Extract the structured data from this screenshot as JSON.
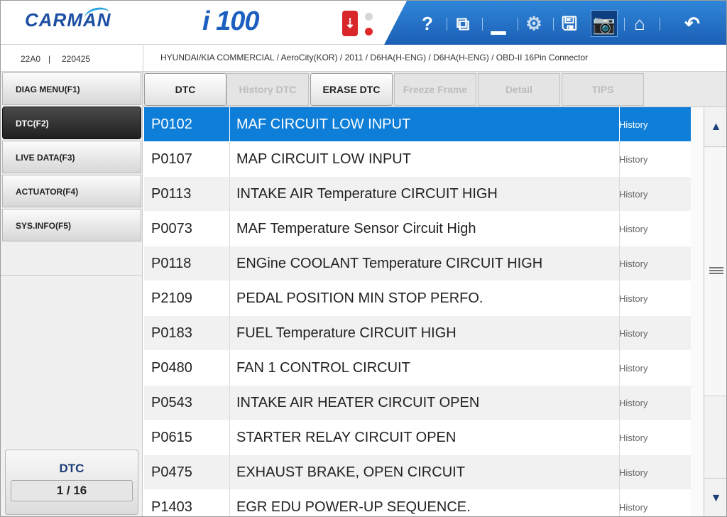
{
  "header": {
    "brand": "CARMAN",
    "model": "i 100",
    "icons": [
      "usb-icon",
      "help-icon",
      "window-icon",
      "minimize-icon",
      "settings-icon",
      "save-icon",
      "camera-icon",
      "home-icon",
      "back-icon"
    ],
    "toolbar": {
      "help": "?",
      "window": "⧉",
      "minimize": "▁",
      "settings": "⚙",
      "save": "🖫",
      "camera": "📷",
      "home": "⌂",
      "back": "↶"
    },
    "usb_label": "⇣"
  },
  "info": {
    "code": "22A0",
    "separator": "|",
    "date": "220425",
    "breadcrumb": "HYUNDAI/KIA COMMERCIAL / AeroCity(KOR) / 2011 / D6HA(H-ENG) / D6HA(H-ENG) / OBD-II 16Pin Connector"
  },
  "sidebar": {
    "items": [
      {
        "label": "DIAG MENU(F1)"
      },
      {
        "label": "DTC(F2)"
      },
      {
        "label": "LIVE DATA(F3)"
      },
      {
        "label": "ACTUATOR(F4)"
      },
      {
        "label": "SYS.INFO(F5)"
      }
    ],
    "active_index": 1,
    "dtc_box": {
      "title": "DTC",
      "count": "1 / 16"
    }
  },
  "tabs": [
    {
      "label": "DTC",
      "enabled": true
    },
    {
      "label": "History DTC",
      "enabled": false
    },
    {
      "label": "ERASE DTC",
      "enabled": true
    },
    {
      "label": "Freeze Frame",
      "enabled": false
    },
    {
      "label": "Detail",
      "enabled": false
    },
    {
      "label": "TIPS",
      "enabled": false
    }
  ],
  "dtc_list": [
    {
      "code": "P0102",
      "description": "MAF CIRCUIT LOW INPUT",
      "status": "History",
      "selected": true
    },
    {
      "code": "P0107",
      "description": "MAP CIRCUIT LOW INPUT",
      "status": "History"
    },
    {
      "code": "P0113",
      "description": "INTAKE AIR Temperature CIRCUIT HIGH",
      "status": "History"
    },
    {
      "code": "P0073",
      "description": "MAF Temperature Sensor Circuit High",
      "status": "History"
    },
    {
      "code": "P0118",
      "description": "ENGine COOLANT Temperature CIRCUIT HIGH",
      "status": "History"
    },
    {
      "code": "P2109",
      "description": "PEDAL POSITION MIN STOP PERFO.",
      "status": "History"
    },
    {
      "code": "P0183",
      "description": "FUEL Temperature CIRCUIT HIGH",
      "status": "History"
    },
    {
      "code": "P0480",
      "description": "FAN 1 CONTROL CIRCUIT",
      "status": "History"
    },
    {
      "code": "P0543",
      "description": "INTAKE AIR HEATER CIRCUIT OPEN",
      "status": "History"
    },
    {
      "code": "P0615",
      "description": "STARTER RELAY CIRCUIT OPEN",
      "status": "History"
    },
    {
      "code": "P0475",
      "description": "EXHAUST BRAKE, OPEN CIRCUIT",
      "status": "History"
    },
    {
      "code": "P1403",
      "description": "EGR EDU POWER-UP SEQUENCE.",
      "status": "History"
    }
  ],
  "scrollbar": {
    "up": "▲",
    "down": "▼"
  },
  "colors": {
    "accent": "#0f7ed8",
    "toolbar": "#1b5fb5",
    "brand": "#1c4fa3"
  }
}
